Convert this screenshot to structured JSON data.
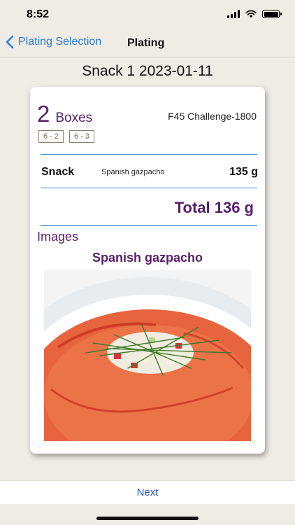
{
  "status_bar": {
    "time": "8:52"
  },
  "nav": {
    "back_label": "Plating Selection",
    "title": "Plating"
  },
  "heading": "Snack 1 2023-01-11",
  "card": {
    "boxes_count": "2",
    "boxes_label": "Boxes",
    "plan_name": "F45 Challenge-1800",
    "tags": [
      "6 - 2",
      "6 - 3"
    ],
    "meal": {
      "name": "Snack",
      "description": "Spanish gazpacho",
      "weight": "135 g"
    },
    "total": "Total 136 g",
    "images_label": "Images",
    "dish_title": "Spanish gazpacho"
  },
  "footer": {
    "next_label": "Next"
  },
  "colors": {
    "accent": "#5a1f6b",
    "link": "#2a7bd6",
    "rule": "#3a86c8",
    "background": "#efebe5"
  }
}
